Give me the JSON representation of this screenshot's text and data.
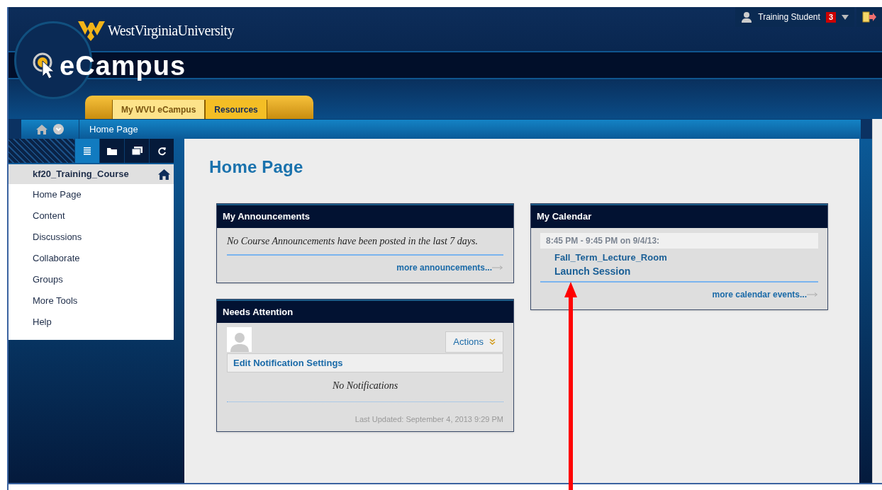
{
  "header": {
    "university": "WestVirginiaUniversity",
    "product": "eCampus",
    "user": "Training Student",
    "notification_count": "3"
  },
  "tabs": [
    {
      "label": "My WVU eCampus",
      "selected": true
    },
    {
      "label": "Resources",
      "selected": false
    }
  ],
  "breadcrumb": "Home Page",
  "sidebar": {
    "tools": [
      {
        "kind": "list",
        "selected": true
      },
      {
        "kind": "folder",
        "selected": false
      },
      {
        "kind": "windows",
        "selected": false
      },
      {
        "kind": "refresh",
        "selected": false
      }
    ],
    "course": "kf20_Training_Course",
    "menu": [
      "Home Page",
      "Content",
      "Discussions",
      "Collaborate",
      "Groups",
      "More Tools",
      "Help"
    ]
  },
  "page_title": "Home Page",
  "announcements": {
    "title": "My Announcements",
    "message": "No Course Announcements have been posted in the last 7 days.",
    "more": "more announcements..."
  },
  "needs_attention": {
    "title": "Needs Attention",
    "actions": "Actions",
    "settings": "Edit Notification Settings",
    "message": "No Notifications",
    "updated": "Last Updated: September 4, 2013 9:29 PM"
  },
  "calendar": {
    "title": "My Calendar",
    "time": "8:45 PM - 9:45 PM on 9/4/13:",
    "event": "Fall_Term_Lecture_Room",
    "launch": "Launch Session",
    "more": "more calendar events..."
  }
}
